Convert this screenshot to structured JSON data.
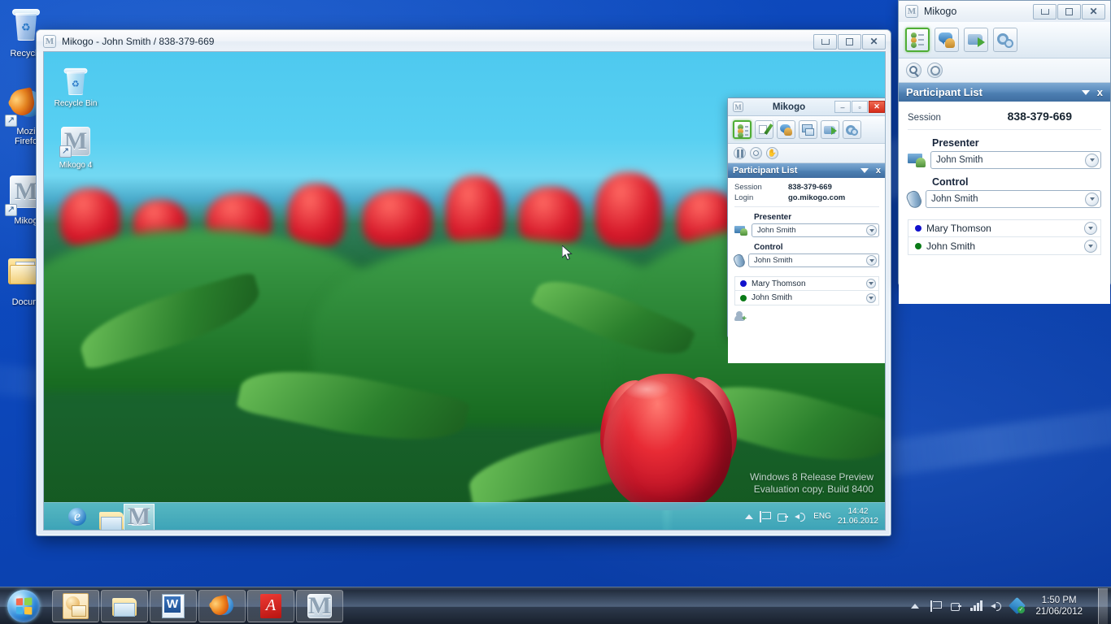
{
  "desktop": {
    "icons": [
      {
        "name": "Recycle",
        "label": "Recycle",
        "glyph": "recycle-bin-icon"
      },
      {
        "name": "Mozi Firefo",
        "label_line1": "Mozi",
        "label_line2": "Firefo",
        "glyph": "firefox-icon"
      },
      {
        "name": "Mikog",
        "label": "Mikog",
        "glyph": "mikogo-icon"
      },
      {
        "name": "Docum",
        "label": "Docum",
        "glyph": "documents-folder-icon"
      }
    ]
  },
  "taskbar": {
    "start_label": "Start",
    "items": [
      {
        "label": "Microsoft Outlook",
        "glyph": "outlook-icon"
      },
      {
        "label": "Windows Explorer",
        "glyph": "explorer-icon"
      },
      {
        "label": "Microsoft Word",
        "glyph": "word-icon"
      },
      {
        "label": "Mozilla Firefox",
        "glyph": "firefox-icon"
      },
      {
        "label": "Adobe Reader",
        "glyph": "pdf-icon"
      },
      {
        "label": "Mikogo",
        "glyph": "mikogo-icon"
      }
    ],
    "tray": {
      "icons": [
        "show-hidden-icons-arrow",
        "action-center-flag-icon",
        "network-icon",
        "signal-bars-icon",
        "volume-icon",
        "dropbox-icon"
      ],
      "time": "1:50 PM",
      "date": "21/06/2012"
    }
  },
  "viewer_window": {
    "title": "Mikogo - John Smith / 838-379-669",
    "icon": "mikogo-icon",
    "buttons": {
      "minimize": "—",
      "maximize": "□",
      "close": "✕"
    }
  },
  "remote_desktop": {
    "icons": [
      {
        "label": "Recycle Bin",
        "glyph": "recycle-bin-icon"
      },
      {
        "label": "Mikogo 4",
        "glyph": "mikogo-icon"
      }
    ],
    "watermark_line1": "Windows 8 Release Preview",
    "watermark_line2": "Evaluation copy. Build 8400",
    "taskbar": {
      "items": [
        {
          "label": "Internet Explorer",
          "glyph": "ie-icon",
          "active": false
        },
        {
          "label": "File Explorer",
          "glyph": "explorer-icon",
          "active": false
        },
        {
          "label": "Mikogo",
          "glyph": "mikogo-icon",
          "active": true
        }
      ],
      "tray": {
        "icons": [
          "show-hidden-icons-arrow",
          "action-center-flag-icon",
          "network-icon",
          "volume-icon"
        ],
        "language": "ENG",
        "time": "14:42",
        "date": "21.06.2012"
      }
    }
  },
  "inner_panel": {
    "title": "Mikogo",
    "window_buttons": {
      "minimize": "–",
      "maximize": "▫",
      "close": "✕"
    },
    "tools": [
      {
        "name": "participant-list",
        "label": "Participant List",
        "selected": true
      },
      {
        "name": "whiteboard",
        "label": "Whiteboard",
        "selected": false
      },
      {
        "name": "chat",
        "label": "Chat",
        "selected": false
      },
      {
        "name": "screen-switch",
        "label": "Switch Screen",
        "selected": false
      },
      {
        "name": "file-transfer",
        "label": "File Transfer",
        "selected": false
      },
      {
        "name": "settings",
        "label": "Settings",
        "selected": false
      }
    ],
    "subtools": [
      {
        "name": "pause",
        "label": "Pause Session"
      },
      {
        "name": "record",
        "label": "Record Session"
      },
      {
        "name": "hand",
        "label": "Raise Hand"
      }
    ],
    "section_title": "Participant List",
    "fields": [
      {
        "label": "Session",
        "value": "838-379-669"
      },
      {
        "label": "Login",
        "value": "go.mikogo.com"
      }
    ],
    "presenter_label": "Presenter",
    "presenter_value": "John Smith",
    "control_label": "Control",
    "control_value": "John Smith",
    "participants": [
      {
        "name": "Mary Thomson",
        "color": "#1111cc"
      },
      {
        "name": "John Smith",
        "color": "#0a7a17"
      }
    ],
    "add_participant_label": "Add participant"
  },
  "right_panel": {
    "window_title": "Mikogo",
    "window_buttons": {
      "minimize": "—",
      "maximize": "□",
      "close": "✕"
    },
    "tools": [
      {
        "name": "participant-list",
        "label": "Participant List",
        "selected": true
      },
      {
        "name": "chat",
        "label": "Chat",
        "selected": false
      },
      {
        "name": "file-transfer",
        "label": "File Transfer",
        "selected": false
      },
      {
        "name": "settings",
        "label": "Settings",
        "selected": false
      }
    ],
    "subtools": [
      {
        "name": "zoom",
        "label": "Zoom"
      },
      {
        "name": "record",
        "label": "Record"
      }
    ],
    "section_title": "Participant List",
    "session_label": "Session",
    "session_value": "838-379-669",
    "presenter_label": "Presenter",
    "presenter_value": "John Smith",
    "control_label": "Control",
    "control_value": "John Smith",
    "participants": [
      {
        "name": "Mary Thomson",
        "color": "#1111cc"
      },
      {
        "name": "John Smith",
        "color": "#0a7a17"
      }
    ]
  },
  "colors": {
    "desktop_blue": "#0c46b9",
    "panel_header_blue": "#5b8cbd",
    "selected_tool_green": "#4fae35",
    "close_red": "#d62b1a",
    "presenter_dot_blue": "#1111cc",
    "presenter_dot_green": "#0a7a17"
  }
}
